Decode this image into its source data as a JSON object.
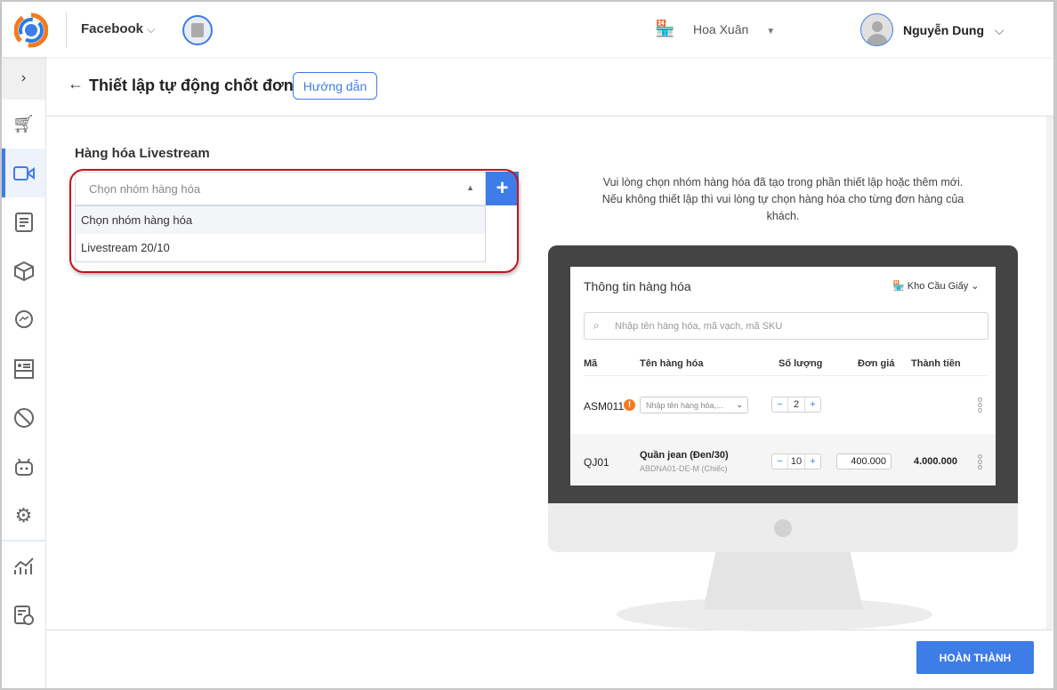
{
  "header": {
    "channel": "Facebook",
    "store": "Hoa Xuân",
    "user": "Nguyễn Dung"
  },
  "page": {
    "title": "Thiết lập tự động chốt đơn",
    "guide_button": "Hướng dẫn"
  },
  "section": {
    "label": "Hàng hóa Livestream",
    "select_placeholder": "Chọn nhóm hàng hóa",
    "add_label": "+",
    "options": [
      "Chọn nhóm hàng hóa",
      "Livestream 20/10"
    ]
  },
  "hint": "Vui lòng chọn nhóm hàng hóa đã tạo trong phần thiết lập hoặc thêm mới. Nếu không thiết lập thì vui lòng tự chọn hàng hóa cho từng đơn hàng của khách.",
  "preview": {
    "title": "Thông tin hàng hóa",
    "warehouse": "Kho Cầu Giấy",
    "search_placeholder": "Nhập tên hàng hóa, mã vạch, mã SKU",
    "columns": [
      "Mã",
      "Tên hàng hóa",
      "Số lượng",
      "Đơn giá",
      "Thành tiền"
    ],
    "rows": [
      {
        "code": "ASM011",
        "name_placeholder": "Nhập tên hàng hóa,...",
        "qty": "2"
      },
      {
        "code": "QJ01",
        "name": "Quần jean (Đen/30)",
        "sku": "ABDNA01-DE-M (Chiếc)",
        "qty": "10",
        "price": "400.000",
        "total": "4.000.000"
      }
    ]
  },
  "footer": {
    "done": "HOÀN THÀNH"
  },
  "colors": {
    "accent": "#3e7ce8",
    "highlight": "#c0161e"
  }
}
